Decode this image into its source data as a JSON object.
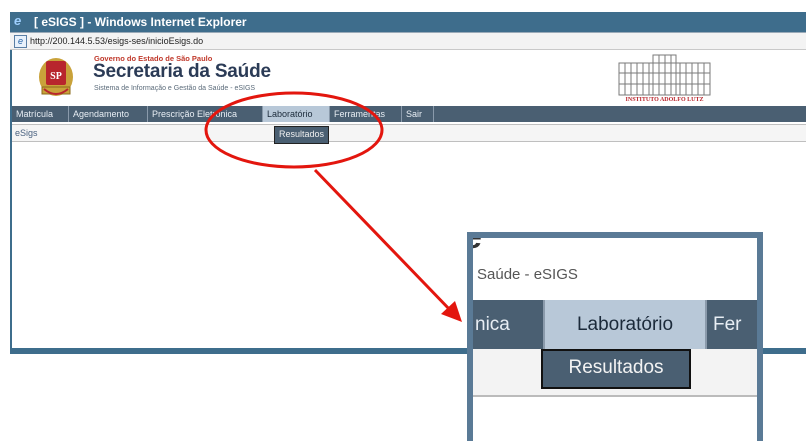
{
  "window": {
    "title": "[ eSIGS ] - Windows Internet Explorer",
    "url": "http://200.144.5.53/esigs-ses/inicioEsigs.do"
  },
  "header": {
    "government": "Governo do Estado de São Paulo",
    "department": "Secretaria da Saúde",
    "subtitle": "Sistema de Informação e Gestão da Saúde - eSIGS",
    "institute": "INSTITUTO ADOLFO LUTZ"
  },
  "menu": {
    "items": [
      "Matrícula",
      "Agendamento",
      "Prescrição Eletrônica",
      "Laboratório",
      "Ferramentas",
      "Sair"
    ],
    "selected": "Laboratório",
    "dropdown_item": "Resultados"
  },
  "breadcrumb": "eSigs",
  "zoom": {
    "big_fragment": "e",
    "subtitle_fragment": "Saúde - eSIGS",
    "left_fragment": "nica",
    "selected": "Laboratório",
    "right_fragment": "Fer",
    "dropdown_item": "Resultados"
  },
  "colors": {
    "window_frame": "#3e6d8c",
    "menu_bar": "#4a5f72",
    "menu_selected": "#b8c8d8",
    "annotation": "#e3160e"
  }
}
